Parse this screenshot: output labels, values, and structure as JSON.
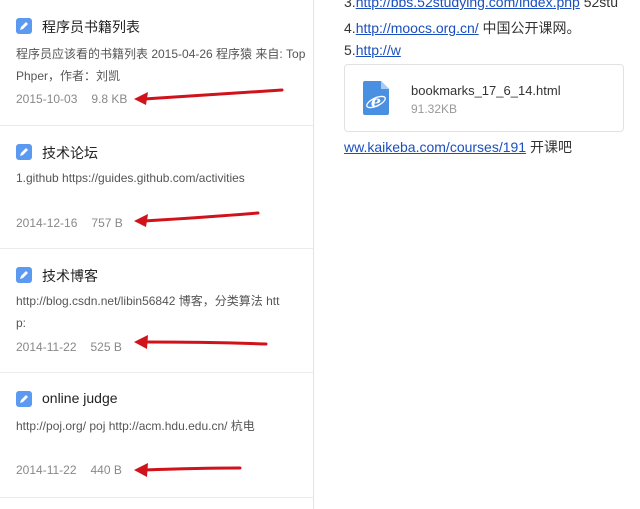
{
  "notes": [
    {
      "title": "程序员书籍列表",
      "snippet": "程序员应该看的书籍列表 2015-04-26 程序猿 来自: TopPhper，作者：刘凯",
      "date": "2015-10-03",
      "size": "9.8 KB"
    },
    {
      "title": "技术论坛",
      "snippet": "1.github https://guides.github.com/activities",
      "date": "2014-12-16",
      "size": "757 B"
    },
    {
      "title": "技术博客",
      "snippet": "http://blog.csdn.net/libin56842 博客，分类算法 http:",
      "date": "2014-11-22",
      "size": "525 B"
    },
    {
      "title": "online judge",
      "snippet": "http://poj.org/ poj http://acm.hdu.edu.cn/ 杭电",
      "date": "2014-11-22",
      "size": "440 B"
    }
  ],
  "editor": {
    "line3": {
      "prefix": "3.",
      "link": "http://bbs.52studying.com/index.php",
      "suffix": " 52stu"
    },
    "line4": {
      "prefix": "4.",
      "link": "http://moocs.org.cn/",
      "suffix": " 中国公开课网。"
    },
    "line5": {
      "prefix": "5.",
      "link": "http://w"
    },
    "attachment": {
      "name": "bookmarks_17_6_14.html",
      "size": "91.32KB",
      "icon": "ie-html-file-icon"
    },
    "line6": {
      "link": "ww.kaikeba.com/courses/191",
      "suffix": " 开课吧"
    }
  },
  "colors": {
    "note_icon": "#5b9af0",
    "arrow": "#d0121b",
    "link": "#1a4fbf"
  }
}
